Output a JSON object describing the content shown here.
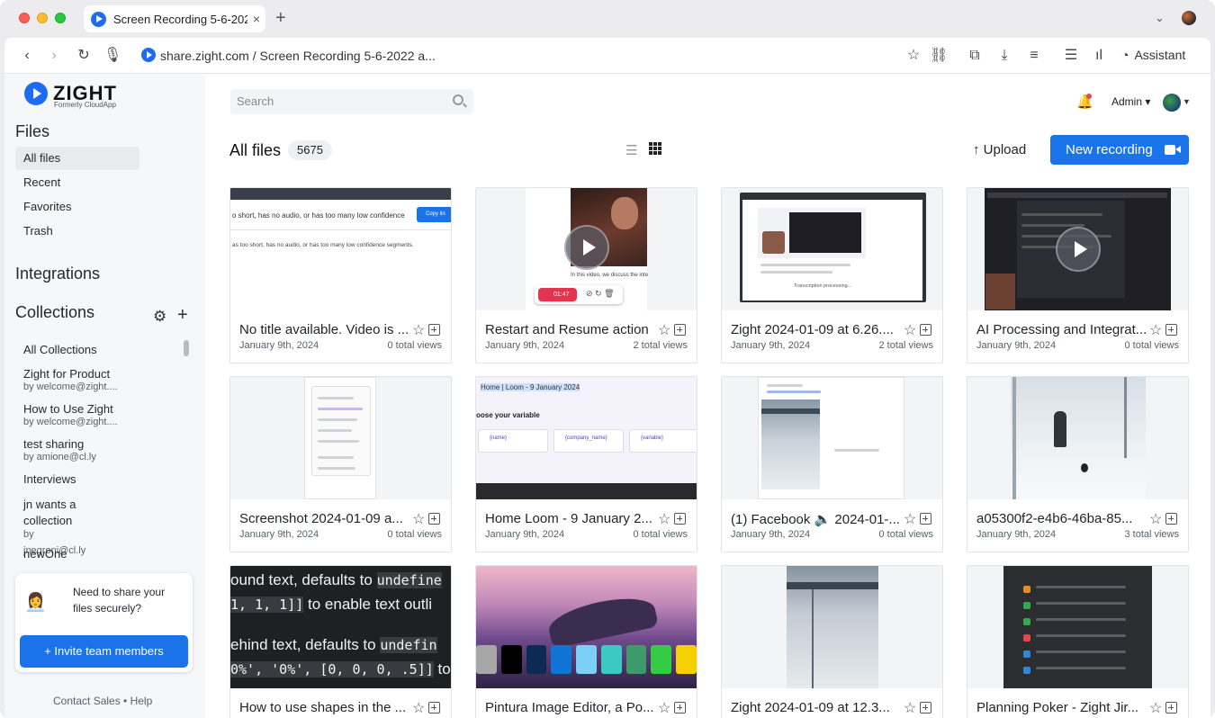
{
  "browser": {
    "tab_title": "Screen Recording 5-6-2022",
    "tab_close": "×",
    "new_tab": "+",
    "url": "share.zight.com / Screen Recording 5-6-2022 a...",
    "assistant_label": "Assistant"
  },
  "brand": {
    "name": "ZIGHT",
    "subtitle": "Formerly CloudApp"
  },
  "sidebar": {
    "files_heading": "Files",
    "files_items": [
      {
        "label": "All files",
        "active": true
      },
      {
        "label": "Recent"
      },
      {
        "label": "Favorites"
      },
      {
        "label": "Trash"
      }
    ],
    "integrations_heading": "Integrations",
    "collections_heading": "Collections",
    "collections": [
      {
        "label": "All Collections",
        "sub": ""
      },
      {
        "label": "Zight for Product",
        "sub": "by welcome@zight...."
      },
      {
        "label": "How to Use Zight",
        "sub": "by welcome@zight...."
      },
      {
        "label": "test sharing",
        "sub": "by amione@cl.ly"
      },
      {
        "label": "Interviews",
        "sub": ""
      },
      {
        "label": "jn wants a collection",
        "sub": "by jnegroni@cl.ly"
      },
      {
        "label": "newOne",
        "sub": ""
      }
    ],
    "invite_text": "Need to share your files securely?",
    "invite_button": "+ Invite team members",
    "footer": "Contact Sales • Help"
  },
  "header": {
    "search_placeholder": "Search",
    "admin_label": "Admin ▾",
    "title": "All files",
    "count": "5675",
    "upload_label": "Upload",
    "new_recording_label": "New recording"
  },
  "cards": [
    {
      "title": "No title available. Video is ...",
      "date": "January 9th, 2024",
      "views": "0 total views"
    },
    {
      "title": "Restart and Resume action",
      "date": "January 9th, 2024",
      "views": "2 total views"
    },
    {
      "title": "Zight 2024-01-09 at 6.26....",
      "date": "January 9th, 2024",
      "views": "2 total views"
    },
    {
      "title": "AI Processing and Integrat...",
      "date": "January 9th, 2024",
      "views": "0 total views"
    },
    {
      "title": "Screenshot 2024-01-09 a...",
      "date": "January 9th, 2024",
      "views": "0 total views"
    },
    {
      "title": "Home Loom - 9 January 2...",
      "date": "January 9th, 2024",
      "views": "0 total views"
    },
    {
      "title": "(1) Facebook 🔈 2024-01-...",
      "date": "January 9th, 2024",
      "views": "0 total views"
    },
    {
      "title": "a05300f2-e4b6-46ba-85...",
      "date": "January 9th, 2024",
      "views": "3 total views"
    },
    {
      "title": "How to use shapes in the ...",
      "date": "",
      "views": ""
    },
    {
      "title": "Pintura Image Editor, a Po...",
      "date": "",
      "views": ""
    },
    {
      "title": "Zight 2024-01-09 at 12.3...",
      "date": "",
      "views": ""
    },
    {
      "title": "Planning Poker - Zight Jir...",
      "date": "",
      "views": ""
    }
  ],
  "thumb_text": {
    "c1_line1": "o short, has no audio, or has too many low confidence",
    "c1_line2": "as too short, has no audio, or has too many low confidence segments.",
    "c1_btn": "Copy lin",
    "c2_timer": "01:47",
    "c2_caption": "In this video, we discuss the inte",
    "c6_header": "Home | Loom - 9 January 2024",
    "c6_sub": "oose your variable",
    "c6_v1": "{name}",
    "c6_v2": "{company_name}",
    "c6_v3": "{variable}",
    "c9_l1": "ound text, defaults to",
    "c9_l1b": "undefine",
    "c9_l2": "1, 1, 1]]",
    "c9_l2b": "to enable text outli",
    "c9_l3": "ehind text, defaults to",
    "c9_l3b": "undefin",
    "c9_l4": "0%', '0%', [0, 0, 0, .5]]",
    "c9_l4b": "to"
  },
  "colors": {
    "accent": "#1a73e8",
    "sidebar_bg": "#f6f7f9"
  }
}
